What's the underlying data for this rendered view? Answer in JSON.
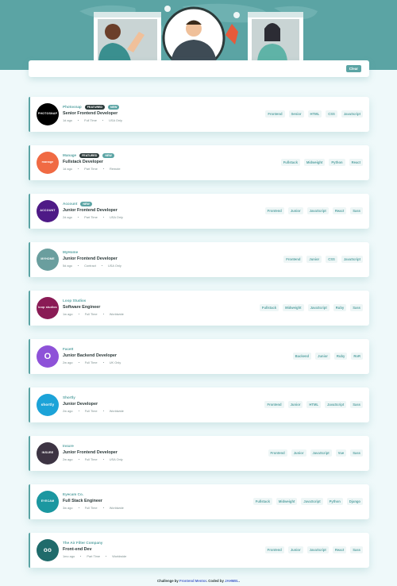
{
  "filter": {
    "clear_label": "Clear"
  },
  "jobs": [
    {
      "company": "Photosnap",
      "logo_text": "PHOTOSNAP",
      "logo_bg": "#000000",
      "new": "NEW",
      "featured": "FEATURED",
      "position": "Senior Frontend Developer",
      "posted": "1d ago",
      "contract": "Full Time",
      "location": "USA Only",
      "tags": [
        "Frontend",
        "Senior",
        "HTML",
        "CSS",
        "JavaScript"
      ]
    },
    {
      "company": "Manage",
      "logo_text": "manage",
      "logo_bg": "#f06a43",
      "new": "NEW",
      "featured": "FEATURED",
      "position": "Fullstack Developer",
      "posted": "1d ago",
      "contract": "Part Time",
      "location": "Remote",
      "tags": [
        "Fullstack",
        "Midweight",
        "Python",
        "React"
      ]
    },
    {
      "company": "Account",
      "logo_text": "ACCOUNT",
      "logo_bg": "#4e1a86",
      "new": "NEW",
      "featured": "",
      "position": "Junior Frontend Developer",
      "posted": "2d ago",
      "contract": "Part Time",
      "location": "USA Only",
      "tags": [
        "Frontend",
        "Junior",
        "JavaScript",
        "React",
        "Sass"
      ]
    },
    {
      "company": "MyHome",
      "logo_text": "MYHOME",
      "logo_bg": "#6a9e9e",
      "new": "",
      "featured": "",
      "position": "Junior Frontend Developer",
      "posted": "5d ago",
      "contract": "Contract",
      "location": "USA Only",
      "tags": [
        "Frontend",
        "Junior",
        "CSS",
        "JavaScript"
      ]
    },
    {
      "company": "Loop Studios",
      "logo_text": "loop studios",
      "logo_bg": "#8a1b55",
      "new": "",
      "featured": "",
      "position": "Software Engineer",
      "posted": "1w ago",
      "contract": "Full Time",
      "location": "Worldwide",
      "tags": [
        "Fullstack",
        "Midweight",
        "JavaScript",
        "Ruby",
        "Sass"
      ]
    },
    {
      "company": "FaceIt",
      "logo_text": "O",
      "logo_bg": "#8e52d8",
      "new": "",
      "featured": "",
      "position": "Junior Backend Developer",
      "posted": "2w ago",
      "contract": "Full Time",
      "location": "UK Only",
      "tags": [
        "Backend",
        "Junior",
        "Ruby",
        "RoR"
      ]
    },
    {
      "company": "Shortly",
      "logo_text": "shortly",
      "logo_bg": "#1ca3d8",
      "new": "",
      "featured": "",
      "position": "Junior Developer",
      "posted": "2w ago",
      "contract": "Full Time",
      "location": "Worldwide",
      "tags": [
        "Frontend",
        "Junior",
        "HTML",
        "JavaScript",
        "Sass"
      ]
    },
    {
      "company": "Insure",
      "logo_text": "INSURE",
      "logo_bg": "#3d3443",
      "new": "",
      "featured": "",
      "position": "Junior Frontend Developer",
      "posted": "2w ago",
      "contract": "Full Time",
      "location": "USA Only",
      "tags": [
        "Frontend",
        "Junior",
        "JavaScript",
        "Vue",
        "Sass"
      ]
    },
    {
      "company": "Eyecam Co.",
      "logo_text": "EYECAM",
      "logo_bg": "#1b97a0",
      "new": "",
      "featured": "",
      "position": "Full Stack Engineer",
      "posted": "3w ago",
      "contract": "Full Time",
      "location": "Worldwide",
      "tags": [
        "Fullstack",
        "Midweight",
        "JavaScript",
        "Python",
        "Django"
      ]
    },
    {
      "company": "The Air Filter Company",
      "logo_text": "oo",
      "logo_bg": "#1f6b6b",
      "new": "",
      "featured": "",
      "position": "Front-end Dev",
      "posted": "1mo ago",
      "contract": "Part Time",
      "location": "Worldwide",
      "tags": [
        "Frontend",
        "Junior",
        "JavaScript",
        "React",
        "Sass"
      ]
    }
  ],
  "footer": {
    "prefix": "Challenge by",
    "mentor": "Frontend Mentor",
    "coded": ". Coded by",
    "author": "JAHMEL",
    "suffix": "."
  },
  "colors": {
    "primary": "#5ba4a4",
    "dark": "#2c3a3a",
    "background": "#eff9fa"
  }
}
